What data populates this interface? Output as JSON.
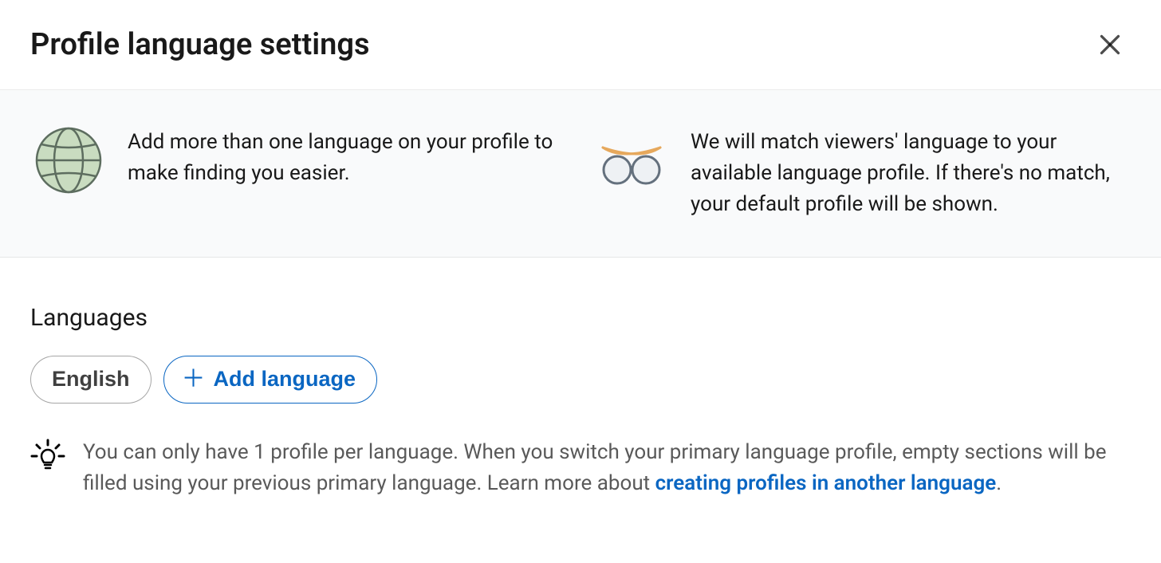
{
  "header": {
    "title": "Profile language settings"
  },
  "banner": {
    "item1": "Add more than one language on your profile to make finding you easier.",
    "item2": "We will match viewers' language to your available language profile. If there's no match, your default profile will be shown."
  },
  "languages": {
    "heading": "Languages",
    "current": "English",
    "add_label": "Add language"
  },
  "tip": {
    "text_before_link": "You can only have 1 profile per language. When you switch your primary language profile, empty sections will be filled using your previous primary language. Learn more about ",
    "link_text": "creating profiles in another language",
    "text_after_link": "."
  }
}
